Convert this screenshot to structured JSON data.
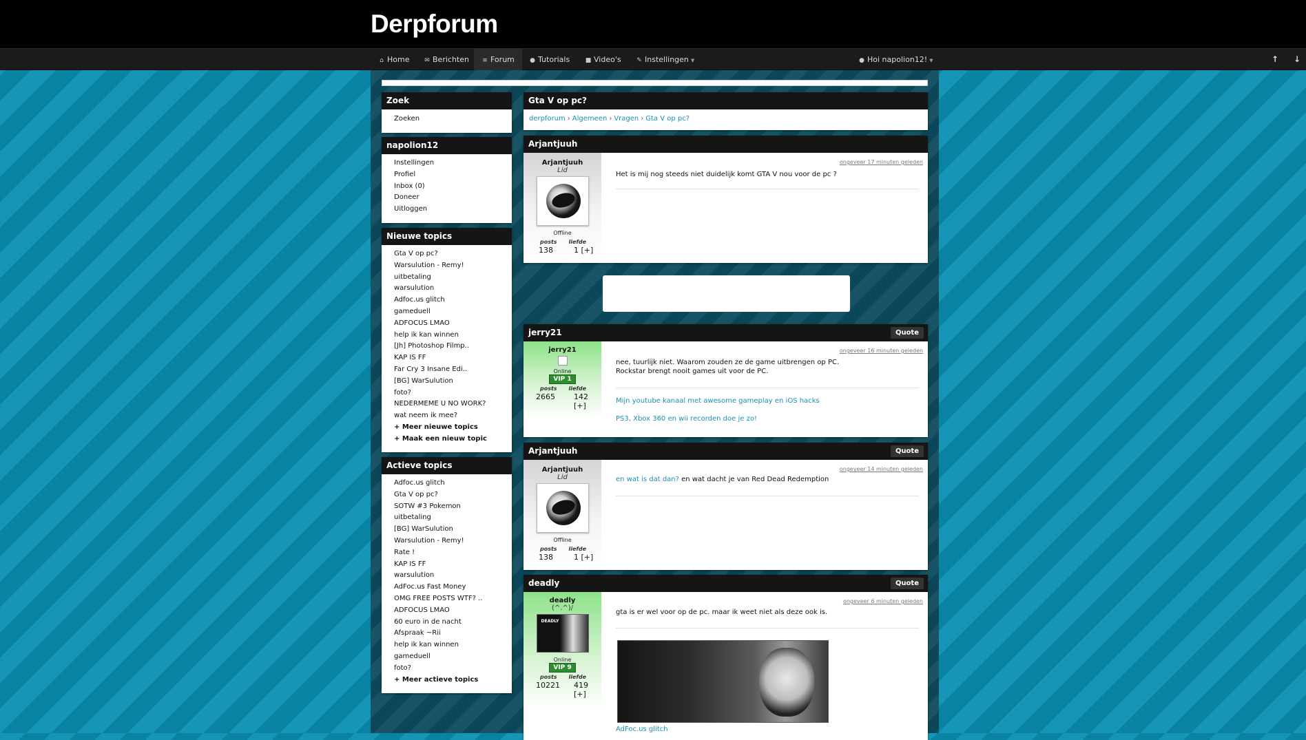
{
  "site": {
    "title": "Derpforum"
  },
  "nav": {
    "items": [
      {
        "icon": "home-icon",
        "glyph": "⌂",
        "label": "Home"
      },
      {
        "icon": "envelope-icon",
        "glyph": "✉",
        "label": "Berichten"
      },
      {
        "icon": "list-icon",
        "glyph": "≡",
        "label": "Forum"
      },
      {
        "icon": "info-icon",
        "glyph": "●",
        "label": "Tutorials"
      },
      {
        "icon": "video-icon",
        "glyph": "■",
        "label": "Video's"
      },
      {
        "icon": "wrench-icon",
        "glyph": "✎",
        "label": "Instellingen"
      }
    ],
    "user_greeting": "Hoi napolion12!",
    "scroll_up": "↑",
    "scroll_down": "↓"
  },
  "sidebar": {
    "search": {
      "title": "Zoek",
      "link": "Zoeken"
    },
    "user": {
      "title": "napolion12",
      "links": [
        "Instellingen",
        "Profiel",
        "Inbox (0)",
        "Doneer",
        "Uitloggen"
      ]
    },
    "new_topics": {
      "title": "Nieuwe topics",
      "items": [
        "Gta V op pc?",
        "Warsulution - Remy!",
        "uitbetaling",
        "warsulution",
        "Adfoc.us glitch",
        "gameduell",
        "ADFOCUS LMAO",
        "help ik kan winnen",
        "[Jh] Photoshop Filmp..",
        "KAP IS FF",
        "Far Cry 3 Insane Edi..",
        "[BG] WarSulution",
        "foto?",
        "NEDERMEME U NO WORK?",
        "wat neem ik mee?"
      ],
      "more": "+ Meer nieuwe topics",
      "create": "+ Maak een nieuw topic"
    },
    "active_topics": {
      "title": "Actieve topics",
      "items": [
        "Adfoc.us glitch",
        "Gta V op pc?",
        "SOTW #3 Pokemon",
        "uitbetaling",
        "[BG] WarSulution",
        "Warsulution - Remy!",
        "Rate !",
        "KAP IS FF",
        "warsulution",
        "AdFoc.us Fast Money",
        "OMG FREE POSTS WTF? ..",
        "ADFOCUS LMAO",
        "60 euro in de nacht",
        "Afspraak ~Rii",
        "help ik kan winnen",
        "gameduell",
        "foto?"
      ],
      "more": "+ Meer actieve topics"
    }
  },
  "topic": {
    "title": "Gta V op pc?",
    "breadcrumb": [
      "derpforum",
      "Algemeen",
      "Vragen",
      "Gta V op pc?"
    ]
  },
  "posts": [
    {
      "header": "Arjantjuuh",
      "author": "Arjantjuuh",
      "rank": "Lid",
      "status": "Offline",
      "posts_label": "posts",
      "love_label": "liefde",
      "posts": "138",
      "love": "1 [+]",
      "time": "ongeveer 17 minuten geleden",
      "text": "Het is mij nog steeds niet duidelijk komt GTA V nou voor de pc ?"
    },
    {
      "header": "jerry21",
      "quote": "Quote",
      "author": "jerry21",
      "status": "Online",
      "vip": "VIP 1",
      "posts_label": "posts",
      "love_label": "liefde",
      "posts": "2665",
      "love": "142 [+]",
      "time": "ongeveer 16 minuten geleden",
      "text": "nee, tuurlijk niet. Waarom zouden ze de game uitbrengen op PC. Rockstar brengt nooit games uit voor de PC.",
      "sig1": "Mijn youtube kanaal met awesome gameplay en iOS hacks",
      "sig2": "PS3, Xbox 360 en wii recorden doe je zo!"
    },
    {
      "header": "Arjantjuuh",
      "quote": "Quote",
      "author": "Arjantjuuh",
      "rank": "Lid",
      "status": "Offline",
      "posts_label": "posts",
      "love_label": "liefde",
      "posts": "138",
      "love": "1 [+]",
      "time": "ongeveer 14 minuten geleden",
      "link_text": "en wat is dat dan?",
      "text": "en wat dacht je van Red Dead Redemption"
    },
    {
      "header": "deadly",
      "quote": "Quote",
      "author": "deadly",
      "rank": "(^.^)/",
      "avatar_text": "DEADLY",
      "status": "Online",
      "vip": "VIP 9",
      "posts_label": "posts",
      "love_label": "liefde",
      "posts": "10221",
      "love": "419 [+]",
      "time": "ongeveer 6 minuten geleden",
      "text": "gta is er wel voor op de pc. maar ik weet niet als deze ook is.",
      "sig1": "AdFoc.us glitch"
    }
  ]
}
